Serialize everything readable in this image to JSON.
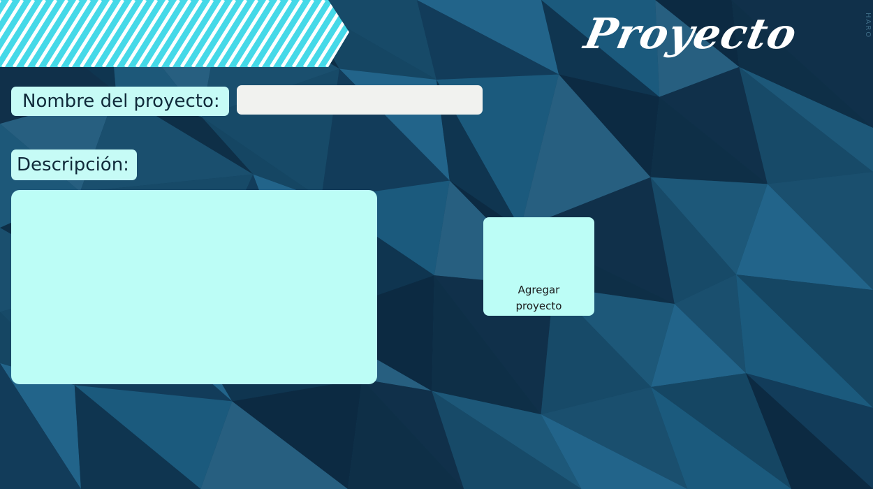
{
  "page": {
    "title": "Proyecto",
    "watermark": "HARO"
  },
  "form": {
    "name_label": "Nombre del proyecto:",
    "name_value": "",
    "description_label": "Descripción:",
    "description_value": "",
    "add_button_label": "Agregar proyecto"
  },
  "colors": {
    "background": "#14405d",
    "banner": "#45d9e8",
    "label_bg": "#c6fbf6",
    "input_bg": "#f1f2ef",
    "textarea_bg": "#bcfdf6",
    "button_bg": "#bcfdf6",
    "title_color": "#ffffff"
  }
}
